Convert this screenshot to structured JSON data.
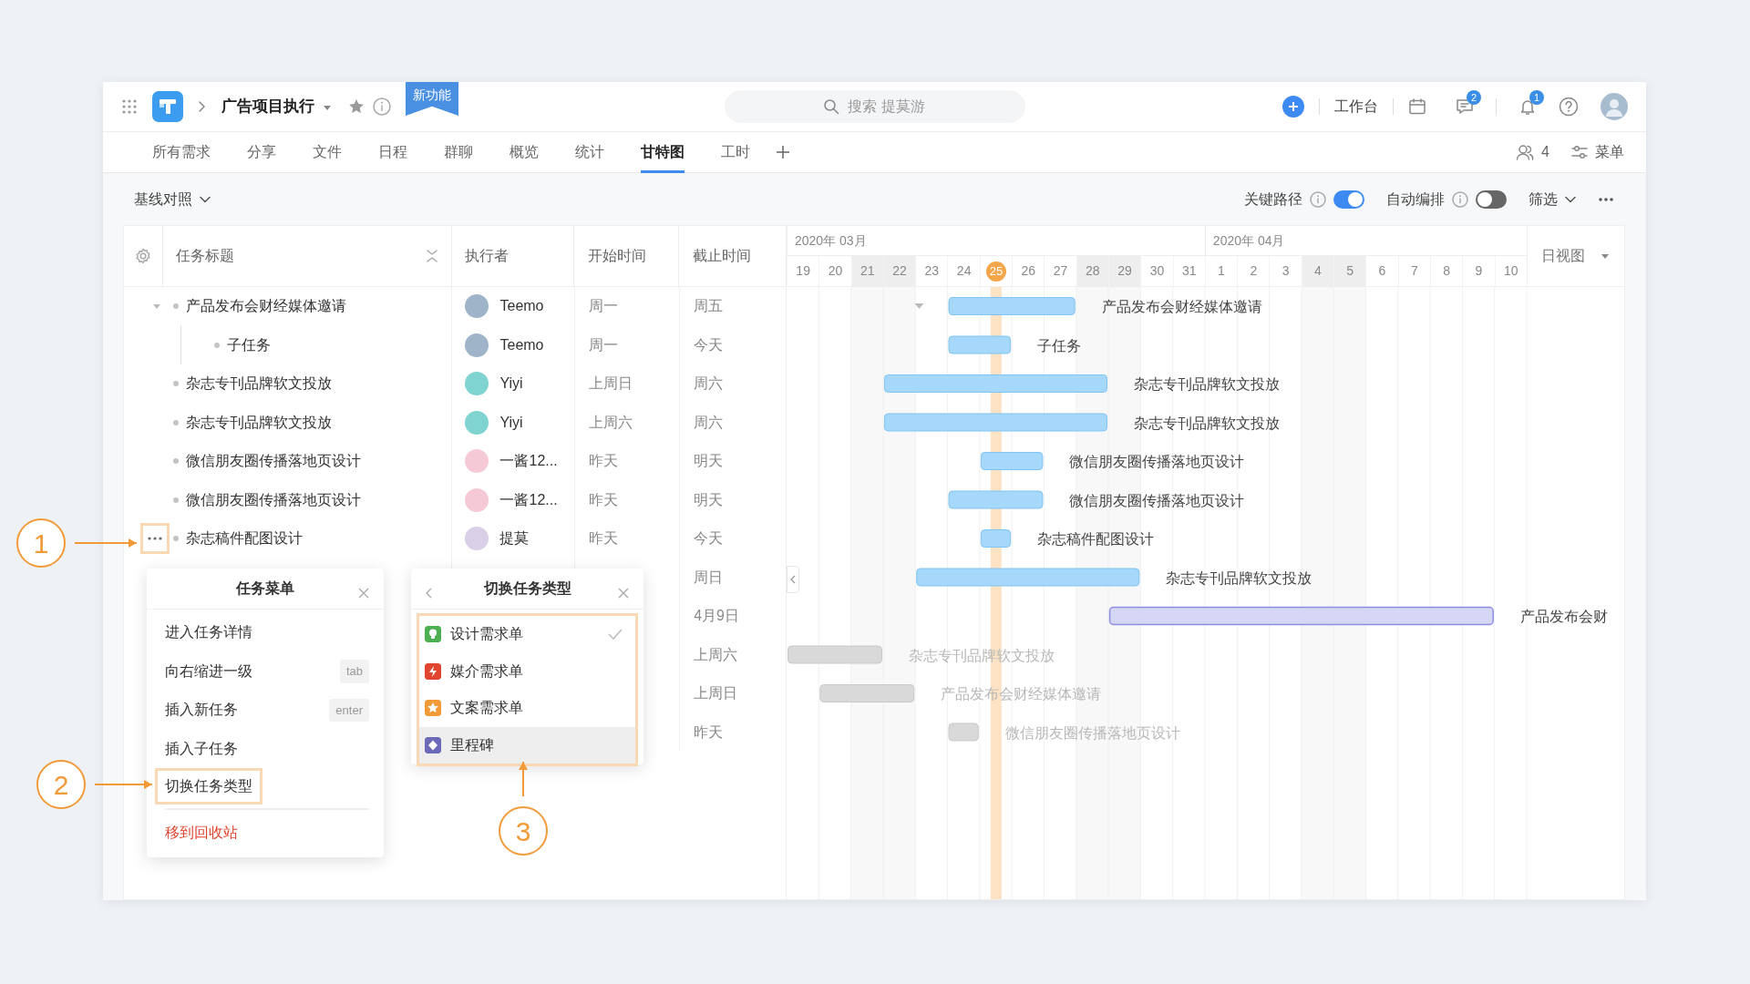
{
  "header": {
    "project": "广告项目执行",
    "new_badge": "新功能",
    "search_placeholder": "搜索 提莫游",
    "workbench": "工作台",
    "chat_count": "2",
    "notice_count": "1"
  },
  "tabs": [
    {
      "label": "所有需求",
      "selected": false
    },
    {
      "label": "分享",
      "selected": false
    },
    {
      "label": "文件",
      "selected": false
    },
    {
      "label": "日程",
      "selected": false
    },
    {
      "label": "群聊",
      "selected": false
    },
    {
      "label": "概览",
      "selected": false
    },
    {
      "label": "统计",
      "selected": false
    },
    {
      "label": "甘特图",
      "selected": true
    },
    {
      "label": "工时",
      "selected": false
    }
  ],
  "members": "4",
  "menu_label": "菜单",
  "toolbar": {
    "baseline": "基线对照",
    "toggles": [
      {
        "label": "关键路径",
        "on": true
      },
      {
        "label": "自动编排",
        "on": false
      }
    ],
    "filter": "筛选"
  },
  "table": {
    "columns": [
      "任务标题",
      "执行者",
      "开始时间",
      "截止时间"
    ]
  },
  "tasks": [
    {
      "title": "产品发布会财经媒体邀请",
      "assignee": {
        "name": "Teemo",
        "color": "#9fb4c9"
      },
      "start": "周一",
      "end": "周五",
      "expanded": true,
      "hover": false,
      "bar": {
        "kind": "task",
        "label": "产品发布会财经媒体邀请"
      },
      "children": [
        {
          "title": "子任务",
          "assignee": {
            "name": "Teemo",
            "color": "#9fb4c9"
          },
          "start": "周一",
          "end": "今天",
          "hover": false,
          "bar": {
            "kind": "task",
            "label": "子任务"
          }
        }
      ]
    },
    {
      "title": "杂志专刊品牌软文投放",
      "assignee": {
        "name": "Yiyi",
        "color": "#7fd3d0"
      },
      "start": "上周日",
      "end": "周六",
      "hover": false,
      "bar": {
        "kind": "task",
        "label": "杂志专刊品牌软文投放"
      }
    },
    {
      "title": "杂志专刊品牌软文投放",
      "assignee": {
        "name": "Yiyi",
        "color": "#7fd3d0"
      },
      "start": "上周六",
      "end": "周六",
      "hover": false,
      "bar": {
        "kind": "task",
        "label": "杂志专刊品牌软文投放"
      }
    },
    {
      "title": "微信朋友圈传播落地页设计",
      "assignee": {
        "name": "一酱12...",
        "color": "#f5c9d6"
      },
      "start": "昨天",
      "end": "明天",
      "hover": false,
      "bar": {
        "kind": "task",
        "label": "微信朋友圈传播落地页设计"
      }
    },
    {
      "title": "微信朋友圈传播落地页设计",
      "assignee": {
        "name": "一酱12...",
        "color": "#f5c9d6"
      },
      "start": "昨天",
      "end": "明天",
      "hover": false,
      "bar": {
        "kind": "task",
        "label": "微信朋友圈传播落地页设计"
      }
    },
    {
      "title": "杂志稿件配图设计",
      "assignee": {
        "name": "提莫",
        "color": "#d9cfe6"
      },
      "start": "昨天",
      "end": "今天",
      "hover": true,
      "bar": {
        "kind": "task",
        "label": "杂志稿件配图设计"
      }
    },
    {
      "end": "周日",
      "hover": false,
      "bar": {
        "kind": "task",
        "label": "杂志专刊品牌软文投放"
      }
    },
    {
      "end": "4月9日",
      "hover": false,
      "bar": {
        "kind": "milestone",
        "label": "产品发布会财"
      }
    },
    {
      "end": "上周六",
      "hover": false,
      "bar": {
        "kind": "baseline",
        "label": "杂志专刊品牌软文投放"
      }
    },
    {
      "end": "上周日",
      "hover": false,
      "bar": {
        "kind": "baseline",
        "label": "产品发布会财经媒体邀请"
      }
    },
    {
      "end": "昨天",
      "hover": false,
      "bar": {
        "kind": "baseline",
        "label": "微信朋友圈传播落地页设计"
      }
    }
  ],
  "timeline": {
    "view": "日视图",
    "months": [
      {
        "label": "2020年 03月",
        "days": [
          {
            "label": "19",
            "weekend": false,
            "today": false
          },
          {
            "label": "20",
            "weekend": false,
            "today": false
          },
          {
            "label": "21",
            "weekend": true,
            "today": false
          },
          {
            "label": "22",
            "weekend": true,
            "today": false
          },
          {
            "label": "23",
            "weekend": false,
            "today": false
          },
          {
            "label": "24",
            "weekend": false,
            "today": false
          },
          {
            "label": "25",
            "weekend": false,
            "today": true
          },
          {
            "label": "26",
            "weekend": false,
            "today": false
          },
          {
            "label": "27",
            "weekend": false,
            "today": false
          },
          {
            "label": "28",
            "weekend": true,
            "today": false
          },
          {
            "label": "29",
            "weekend": true,
            "today": false
          },
          {
            "label": "30",
            "weekend": false,
            "today": false
          },
          {
            "label": "31",
            "weekend": false,
            "today": false
          }
        ]
      },
      {
        "label": "2020年 04月",
        "days": [
          {
            "label": "1",
            "weekend": false,
            "today": false
          },
          {
            "label": "2",
            "weekend": false,
            "today": false
          },
          {
            "label": "3",
            "weekend": false,
            "today": false
          },
          {
            "label": "4",
            "weekend": true,
            "today": false
          },
          {
            "label": "5",
            "weekend": true,
            "today": false
          },
          {
            "label": "6",
            "weekend": false,
            "today": false
          },
          {
            "label": "7",
            "weekend": false,
            "today": false
          },
          {
            "label": "8",
            "weekend": false,
            "today": false
          },
          {
            "label": "9",
            "weekend": false,
            "today": false
          },
          {
            "label": "10",
            "weekend": false,
            "today": false
          }
        ]
      }
    ]
  },
  "task_menu": {
    "title": "任务菜单",
    "items": [
      {
        "label": "进入任务详情",
        "highlighted": false,
        "danger": false
      },
      {
        "label": "向右缩进一级",
        "shortcut": "tab",
        "highlighted": false,
        "danger": false
      },
      {
        "label": "插入新任务",
        "shortcut": "enter",
        "highlighted": false,
        "danger": false
      },
      {
        "label": "插入子任务",
        "highlighted": false,
        "danger": false
      },
      {
        "label": "切换任务类型",
        "highlighted": true,
        "danger": false
      },
      {
        "label": "移到回收站",
        "highlighted": false,
        "danger": true
      }
    ]
  },
  "type_menu": {
    "title": "切换任务类型",
    "highlighted": true,
    "items": [
      {
        "label": "设计需求单",
        "kind": "bulb",
        "color": "#4caf50",
        "checked": true,
        "hovered": false
      },
      {
        "label": "媒介需求单",
        "kind": "bolt",
        "color": "#e0452f",
        "checked": false,
        "hovered": false
      },
      {
        "label": "文案需求单",
        "kind": "star",
        "color": "#f29a38",
        "checked": false,
        "hovered": false
      },
      {
        "label": "里程碑",
        "kind": "diamond",
        "color": "#6a6ab8",
        "checked": false,
        "hovered": true
      }
    ]
  },
  "annotations": [
    {
      "label": "1"
    },
    {
      "label": "2"
    },
    {
      "label": "3"
    }
  ]
}
